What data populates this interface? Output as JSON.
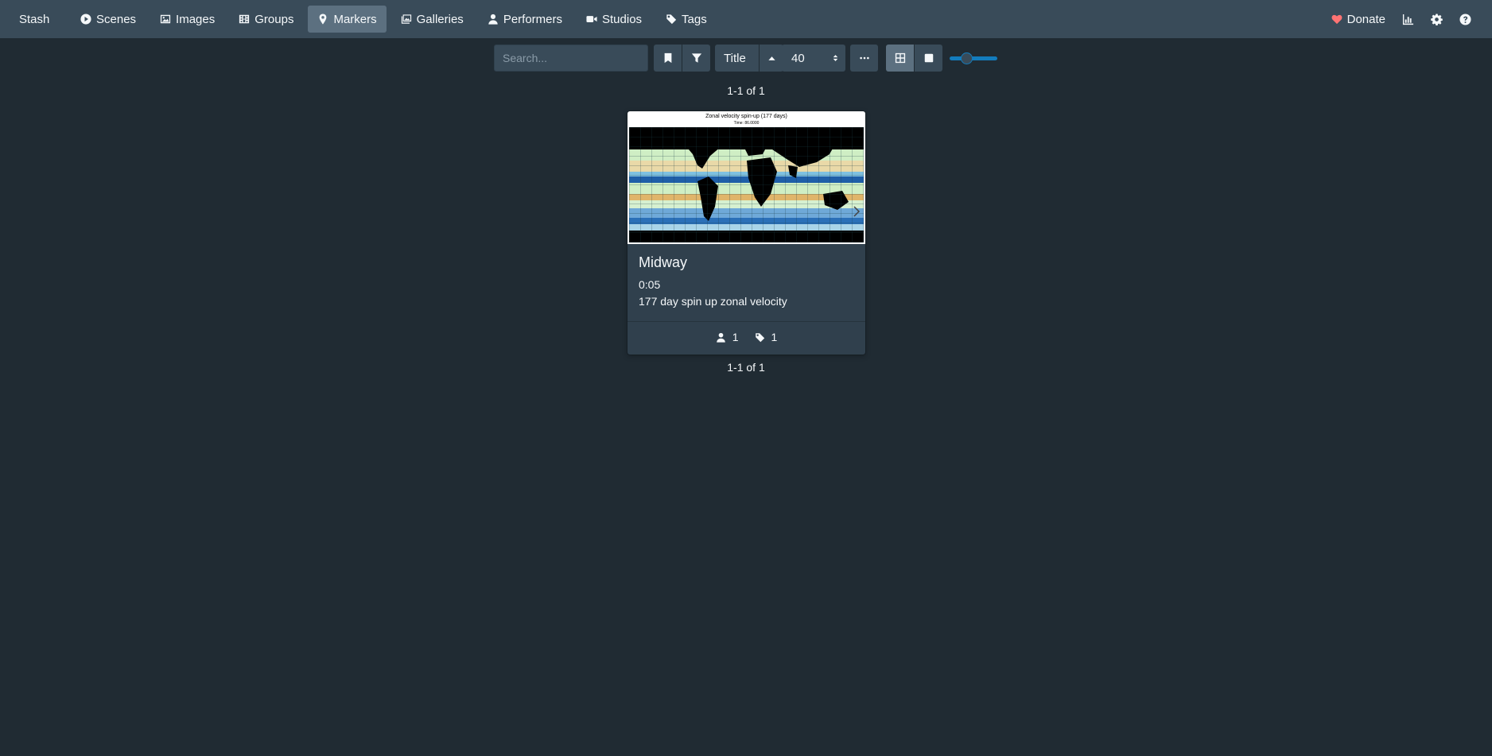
{
  "navbar": {
    "brand": "Stash",
    "items": [
      {
        "label": "Scenes",
        "icon": "play-circle-icon",
        "active": false
      },
      {
        "label": "Images",
        "icon": "image-icon",
        "active": false
      },
      {
        "label": "Groups",
        "icon": "film-icon",
        "active": false
      },
      {
        "label": "Markers",
        "icon": "map-marker-icon",
        "active": true
      },
      {
        "label": "Galleries",
        "icon": "images-icon",
        "active": false
      },
      {
        "label": "Performers",
        "icon": "user-icon",
        "active": false
      },
      {
        "label": "Studios",
        "icon": "video-icon",
        "active": false
      },
      {
        "label": "Tags",
        "icon": "tag-icon",
        "active": false
      }
    ],
    "donate_label": "Donate",
    "right_icons": [
      "chart-icon",
      "gear-icon",
      "help-icon"
    ]
  },
  "toolbar": {
    "search_placeholder": "Search...",
    "sort_by": "Title",
    "per_page": "40",
    "display_mode": "grid",
    "zoom_level": 1
  },
  "pagination": {
    "top": "1-1 of 1",
    "bottom": "1-1 of 1"
  },
  "marker": {
    "image_title": "Zonal velocity spin-up (177 days)",
    "image_subtitle": "Time: 86.0000",
    "title": "Midway",
    "time": "0:05",
    "description": "177 day spin up zonal velocity",
    "performer_count": "1",
    "tag_count": "1"
  },
  "colors": {
    "background": "#202b33",
    "navbar": "#394b59",
    "card": "#30404d",
    "accent": "#137cbd",
    "donate_heart": "#ff7373"
  }
}
